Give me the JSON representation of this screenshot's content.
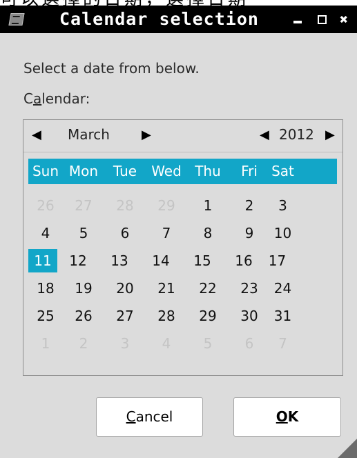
{
  "window": {
    "title": "Calendar selection",
    "buttons": [
      "minimize",
      "maximize",
      "close"
    ]
  },
  "behind_text": "可以選擇的日期，選擇日期",
  "prompt": "Select a date from below.",
  "calendar_label": {
    "before": "C",
    "mnemonic": "a",
    "after": "lendar:"
  },
  "calendar": {
    "month": "March",
    "year": "2012",
    "selected_day": "11",
    "weekdays": [
      "Sun",
      "Mon",
      "Tue",
      "Wed",
      "Thu",
      "Fri",
      "Sat"
    ],
    "weeks": [
      [
        {
          "d": "26",
          "other": true
        },
        {
          "d": "27",
          "other": true
        },
        {
          "d": "28",
          "other": true
        },
        {
          "d": "29",
          "other": true
        },
        {
          "d": "1"
        },
        {
          "d": "2"
        },
        {
          "d": "3"
        }
      ],
      [
        {
          "d": "4"
        },
        {
          "d": "5"
        },
        {
          "d": "6"
        },
        {
          "d": "7"
        },
        {
          "d": "8"
        },
        {
          "d": "9"
        },
        {
          "d": "10"
        }
      ],
      [
        {
          "d": "11",
          "selected": true
        },
        {
          "d": "12"
        },
        {
          "d": "13"
        },
        {
          "d": "14"
        },
        {
          "d": "15"
        },
        {
          "d": "16"
        },
        {
          "d": "17"
        }
      ],
      [
        {
          "d": "18"
        },
        {
          "d": "19"
        },
        {
          "d": "20"
        },
        {
          "d": "21"
        },
        {
          "d": "22"
        },
        {
          "d": "23"
        },
        {
          "d": "24"
        }
      ],
      [
        {
          "d": "25"
        },
        {
          "d": "26"
        },
        {
          "d": "27"
        },
        {
          "d": "28"
        },
        {
          "d": "29"
        },
        {
          "d": "30"
        },
        {
          "d": "31"
        }
      ],
      [
        {
          "d": "1",
          "other": true
        },
        {
          "d": "2",
          "other": true
        },
        {
          "d": "3",
          "other": true
        },
        {
          "d": "4",
          "other": true
        },
        {
          "d": "5",
          "other": true
        },
        {
          "d": "6",
          "other": true
        },
        {
          "d": "7",
          "other": true
        }
      ]
    ]
  },
  "buttons": {
    "cancel": {
      "mnemonic": "C",
      "rest": "ancel"
    },
    "ok": {
      "mnemonic": "O",
      "rest": "K"
    }
  },
  "colors": {
    "accent": "#12a6c8",
    "titlebar": "#000000",
    "background": "#dcdcdc"
  }
}
